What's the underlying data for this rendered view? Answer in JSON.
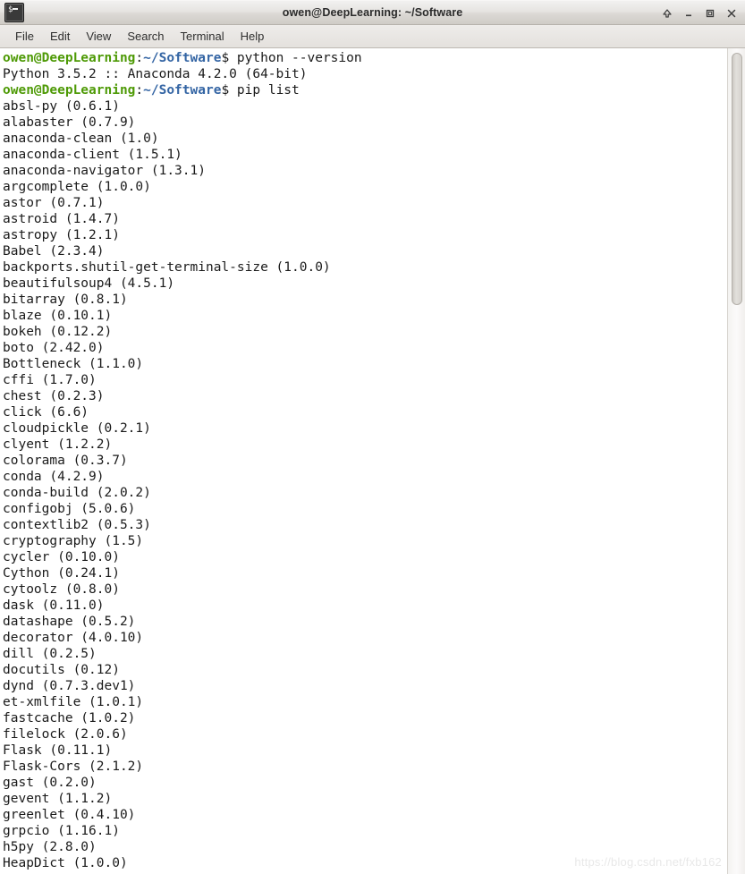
{
  "window": {
    "title": "owen@DeepLearning: ~/Software",
    "icon": "terminal-icon",
    "buttons": [
      {
        "name": "shade-button",
        "glyph": "↑"
      },
      {
        "name": "minimize-button",
        "glyph": "–"
      },
      {
        "name": "maximize-button",
        "glyph": "□"
      },
      {
        "name": "close-button",
        "glyph": "✕"
      }
    ]
  },
  "menubar": {
    "items": [
      "File",
      "Edit",
      "View",
      "Search",
      "Terminal",
      "Help"
    ]
  },
  "prompt": {
    "user_host": "owen@DeepLearning",
    "separator": ":",
    "path": "~/Software",
    "sigil": "$"
  },
  "terminal": {
    "commands": [
      {
        "type": "prompt",
        "command": " python --version"
      },
      {
        "type": "output",
        "text": "Python 3.5.2 :: Anaconda 4.2.0 (64-bit)"
      },
      {
        "type": "prompt",
        "command": " pip list"
      }
    ],
    "packages": [
      "absl-py (0.6.1)",
      "alabaster (0.7.9)",
      "anaconda-clean (1.0)",
      "anaconda-client (1.5.1)",
      "anaconda-navigator (1.3.1)",
      "argcomplete (1.0.0)",
      "astor (0.7.1)",
      "astroid (1.4.7)",
      "astropy (1.2.1)",
      "Babel (2.3.4)",
      "backports.shutil-get-terminal-size (1.0.0)",
      "beautifulsoup4 (4.5.1)",
      "bitarray (0.8.1)",
      "blaze (0.10.1)",
      "bokeh (0.12.2)",
      "boto (2.42.0)",
      "Bottleneck (1.1.0)",
      "cffi (1.7.0)",
      "chest (0.2.3)",
      "click (6.6)",
      "cloudpickle (0.2.1)",
      "clyent (1.2.2)",
      "colorama (0.3.7)",
      "conda (4.2.9)",
      "conda-build (2.0.2)",
      "configobj (5.0.6)",
      "contextlib2 (0.5.3)",
      "cryptography (1.5)",
      "cycler (0.10.0)",
      "Cython (0.24.1)",
      "cytoolz (0.8.0)",
      "dask (0.11.0)",
      "datashape (0.5.2)",
      "decorator (4.0.10)",
      "dill (0.2.5)",
      "docutils (0.12)",
      "dynd (0.7.3.dev1)",
      "et-xmlfile (1.0.1)",
      "fastcache (1.0.2)",
      "filelock (2.0.6)",
      "Flask (0.11.1)",
      "Flask-Cors (2.1.2)",
      "gast (0.2.0)",
      "gevent (1.1.2)",
      "greenlet (0.4.10)",
      "grpcio (1.16.1)",
      "h5py (2.8.0)",
      "HeapDict (1.0.0)"
    ]
  },
  "watermark": {
    "text": "https://blog.csdn.net/fxb162"
  },
  "colors": {
    "prompt_user": "#4e9a06",
    "prompt_path": "#3465a4",
    "text": "#1a1a1a",
    "background": "#ffffff"
  }
}
